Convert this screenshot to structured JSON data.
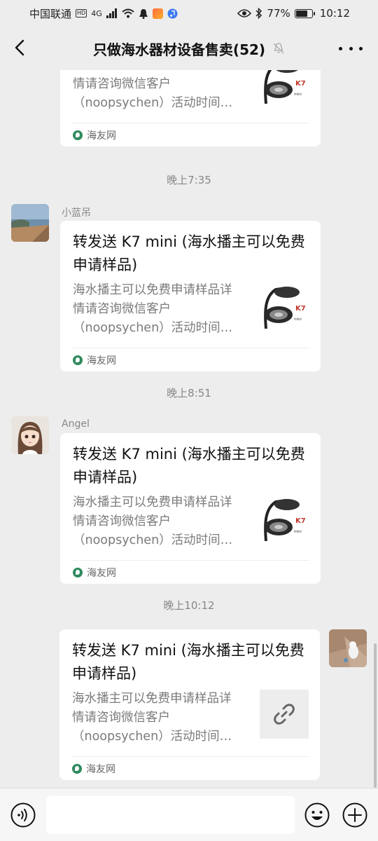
{
  "status_bar": {
    "carrier": "中国联通",
    "hd_badge": "HD",
    "network": "4G",
    "battery_text": "77%",
    "battery_level": 0.77,
    "time": "10:12"
  },
  "nav": {
    "title": "只做海水器材设备售卖(52)"
  },
  "messages": [
    {
      "desc": "海水播主可以免费申请样品详情请咨询微信客户（noopsychen）活动时间…",
      "source": "海友网"
    },
    {
      "time": "晚上7:35",
      "sender": "小蓝吊",
      "title": "转发送 K7 mini (海水播主可以免费申请样品)",
      "desc": "海水播主可以免费申请样品详情请咨询微信客户（noopsychen）活动时间…",
      "source": "海友网"
    },
    {
      "time": "晚上8:51",
      "sender": "Angel",
      "title": "转发送 K7 mini (海水播主可以免费申请样品)",
      "desc": "海水播主可以免费申请样品详情请咨询微信客户（noopsychen）活动时间…",
      "source": "海友网"
    },
    {
      "time": "晚上10:12",
      "title": "转发送 K7 mini (海水播主可以免费申请样品)",
      "desc": "海水播主可以免费申请样品详情请咨询微信客户（noopsychen）活动时间…",
      "source": "海友网"
    }
  ],
  "icons": {
    "back": "chevron-left-icon",
    "mute": "bell-off-icon",
    "more": "more-dots-icon",
    "voice": "voice-icon",
    "emoji": "emoji-icon",
    "plus": "plus-icon",
    "link": "link-icon",
    "source": "haiyou-logo-icon"
  },
  "colors": {
    "background": "#ededed",
    "card": "#ffffff",
    "source_logo": "#2f8a5e"
  }
}
